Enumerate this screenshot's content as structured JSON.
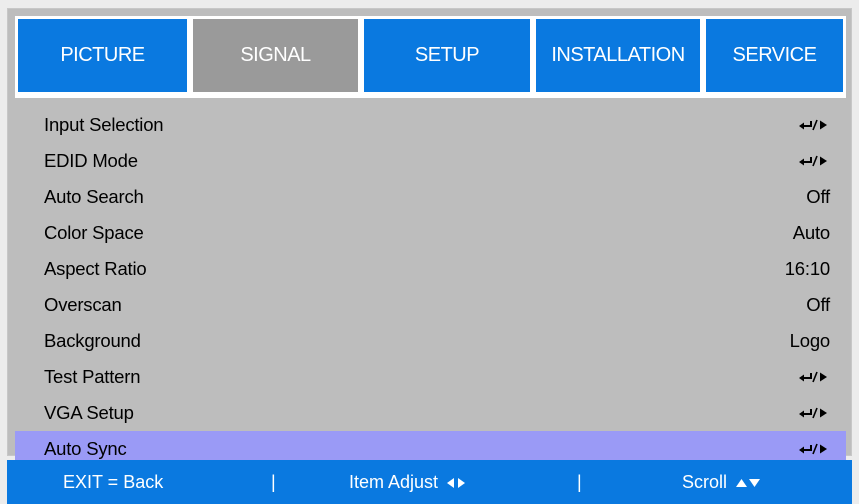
{
  "tabs": [
    {
      "label": "PICTURE",
      "active": false
    },
    {
      "label": "SIGNAL",
      "active": true
    },
    {
      "label": "SETUP",
      "active": false
    },
    {
      "label": "INSTALLATION",
      "active": false
    },
    {
      "label": "SERVICE",
      "active": false
    }
  ],
  "menu": {
    "items": [
      {
        "label": "Input Selection",
        "value": "",
        "value_icon": "enter-right-icon"
      },
      {
        "label": "EDID Mode",
        "value": "",
        "value_icon": "enter-right-icon"
      },
      {
        "label": "Auto Search",
        "value": "Off"
      },
      {
        "label": "Color Space",
        "value": "Auto"
      },
      {
        "label": "Aspect Ratio",
        "value": "16:10"
      },
      {
        "label": "Overscan",
        "value": "Off"
      },
      {
        "label": "Background",
        "value": "Logo"
      },
      {
        "label": "Test Pattern",
        "value": "",
        "value_icon": "enter-right-icon"
      },
      {
        "label": "VGA Setup",
        "value": "",
        "value_icon": "enter-right-icon"
      },
      {
        "label": "Auto Sync",
        "value": "",
        "value_icon": "enter-right-icon",
        "selected": true
      }
    ]
  },
  "footer": {
    "exit_label": "EXIT = Back",
    "separator": "|",
    "adjust_label": "Item Adjust",
    "adjust_icon": "left-right-arrows-icon",
    "scroll_label": "Scroll",
    "scroll_icon": "up-down-arrows-icon"
  },
  "colors": {
    "tab_blue": "#0a79e0",
    "tab_active": "#9a9a9a",
    "panel": "#bdbdbd",
    "selected_row": "#9a9af6"
  }
}
